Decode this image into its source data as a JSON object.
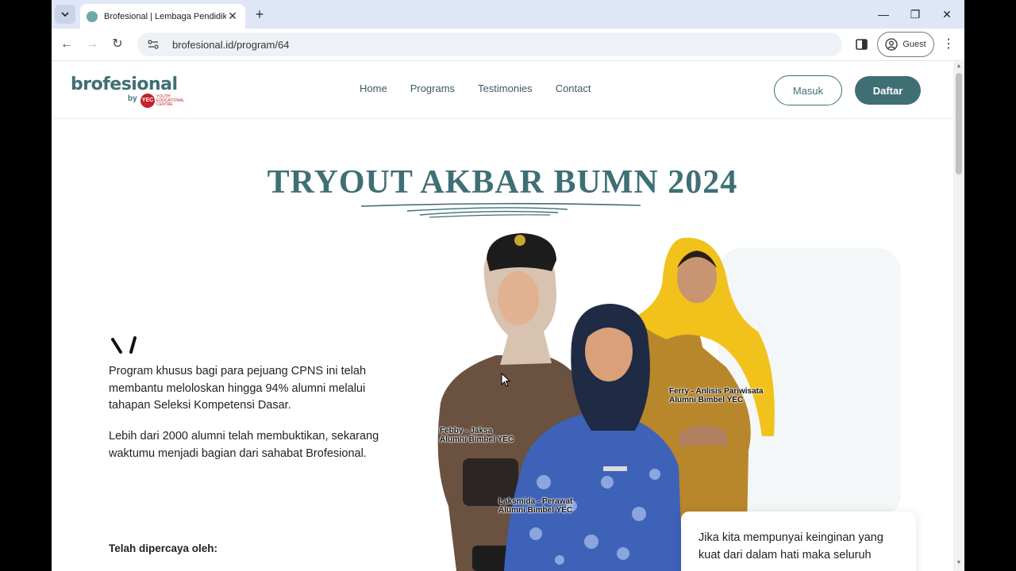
{
  "browser": {
    "tab_title": "Brofesional | Lembaga Pendidikan",
    "url": "brofesional.id/program/64",
    "profile_label": "Guest"
  },
  "site": {
    "logo_text": "brofesional",
    "logo_by": "by",
    "logo_badge": "YEC",
    "logo_badge_sub": "YOUTH EDUCATIONAL CENTRE",
    "nav": [
      "Home",
      "Programs",
      "Testimonies",
      "Contact"
    ],
    "login_label": "Masuk",
    "register_label": "Daftar",
    "brand_color": "#3f6f75"
  },
  "hero": {
    "title": "TRYOUT AKBAR BUMN 2024",
    "paragraph1": "Program khusus bagi para pejuang CPNS ini telah membantu meloloskan hingga 94% alumni melalui tahapan Seleksi Kompetensi Dasar.",
    "paragraph2": "Lebih dari 2000 alumni telah membuktikan, sekarang waktumu menjadi bagian dari sahabat Brofesional.",
    "trusted_label": "Telah dipercaya oleh:",
    "captions": {
      "left": [
        "Febby - Jaksa",
        "Alumni Bimbel YEC"
      ],
      "right": [
        "Ferry - Anlisis Pariwisata",
        "Alumni Bimbel YEC"
      ],
      "center": [
        "Laksmida - Perawat",
        "Alumni Bimbel YEC"
      ]
    },
    "testimonial": "Jika kita mempunyai keinginan yang kuat dari dalam hati maka seluruh"
  }
}
